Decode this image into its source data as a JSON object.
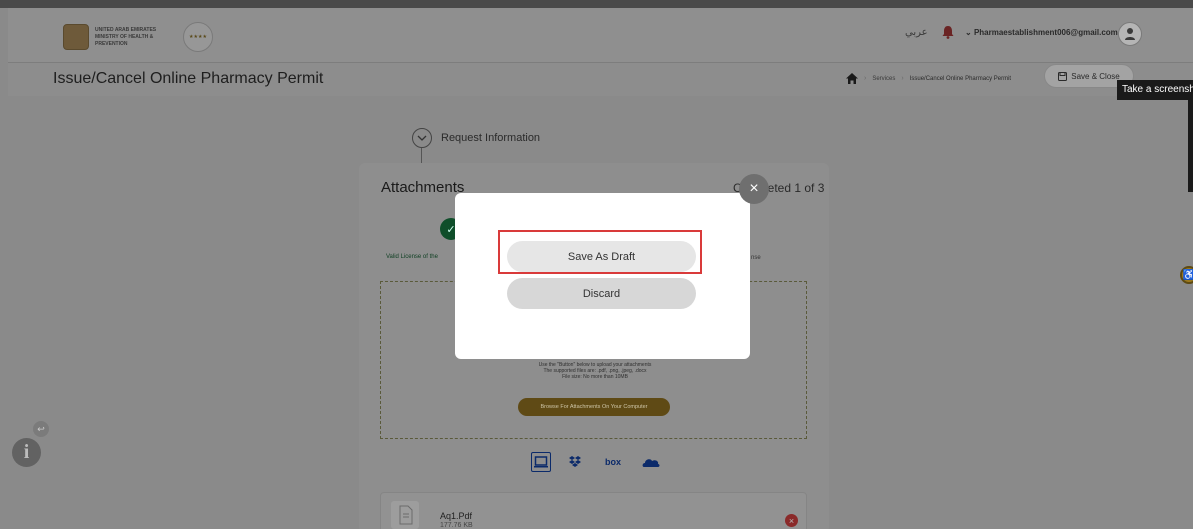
{
  "header": {
    "ministry_line1": "UNITED ARAB EMIRATES",
    "ministry_line2": "MINISTRY OF HEALTH & PREVENTION",
    "language": "عربي",
    "user_email": "Pharmaestablishment006@gmail.com",
    "icons": [
      "emblem-icon",
      "stars-badge-icon",
      "bell-icon",
      "chevron-down-icon",
      "user-icon"
    ]
  },
  "titlebar": {
    "page_title": "Issue/Cancel Online Pharmacy Permit",
    "breadcrumb": [
      "Services",
      "Issue/Cancel Online Pharmacy Permit"
    ],
    "save_close_label": "Save & Close"
  },
  "tooltip": "Take a screenshot",
  "step": {
    "label": "Request Information"
  },
  "attachments": {
    "title": "Attachments",
    "completed": "Completed 1 of 3",
    "license_label": "Valid License of the",
    "right_label": "nse",
    "dropzone_text": [
      "Use the \"Button\" below to upload your attachments",
      "The supported files are: .pdf, .png, .jpeg, .docx",
      "File size: No more than 10MB"
    ],
    "browse_label": "Browse For Attachments On Your Computer",
    "sources": [
      "computer-icon",
      "dropbox-icon",
      "box-icon",
      "onedrive-icon"
    ],
    "box_label": "box",
    "file": {
      "name": "Aq1.Pdf",
      "size": "177.76 KB"
    }
  },
  "modal": {
    "save_draft_label": "Save As Draft",
    "discard_label": "Discard",
    "close_glyph": "×"
  },
  "colors": {
    "accent_gold": "#a07a18",
    "success_green": "#0f4e2a",
    "highlight_red": "#d93a3a"
  }
}
